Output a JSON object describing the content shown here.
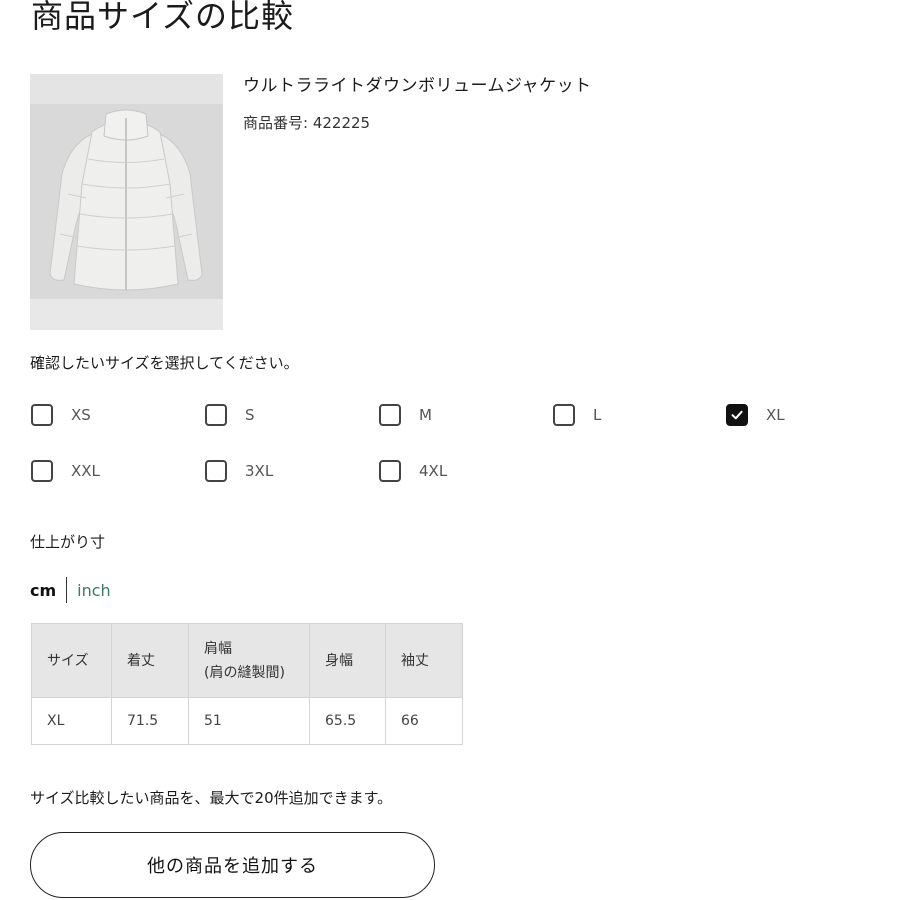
{
  "page": {
    "title": "商品サイズの比較"
  },
  "product": {
    "name": "ウルトラライトダウンボリュームジャケット",
    "number_text": "商品番号: 422225",
    "image_icon": "puffer-jacket-image"
  },
  "size_selector": {
    "prompt": "確認したいサイズを選択してください。",
    "options": [
      {
        "label": "XS",
        "checked": false
      },
      {
        "label": "S",
        "checked": false
      },
      {
        "label": "M",
        "checked": false
      },
      {
        "label": "L",
        "checked": false
      },
      {
        "label": "XL",
        "checked": true
      },
      {
        "label": "XXL",
        "checked": false
      },
      {
        "label": "3XL",
        "checked": false
      },
      {
        "label": "4XL",
        "checked": false
      }
    ]
  },
  "measurements": {
    "section_label": "仕上がり寸",
    "units": {
      "cm": "cm",
      "inch": "inch",
      "selected": "cm"
    },
    "table": {
      "headers": [
        "サイズ",
        "着丈",
        "肩幅\n(肩の縫製間)",
        "身幅",
        "袖丈"
      ],
      "header_line1": [
        "サイズ",
        "着丈",
        "肩幅",
        "身幅",
        "袖丈"
      ],
      "header_line2": [
        "",
        "",
        "(肩の縫製間)",
        "",
        ""
      ],
      "rows": [
        [
          "XL",
          "71.5",
          "51",
          "65.5",
          "66"
        ]
      ]
    }
  },
  "compare": {
    "note": "サイズ比較したい商品を、最大で20件追加できます。",
    "add_button_label": "他の商品を追加する"
  },
  "colors": {
    "accent_inch": "#3b7a6b",
    "checked_box": "#111111",
    "table_header_bg": "#e6e6e6",
    "image_bg": "#e3e3e3"
  }
}
